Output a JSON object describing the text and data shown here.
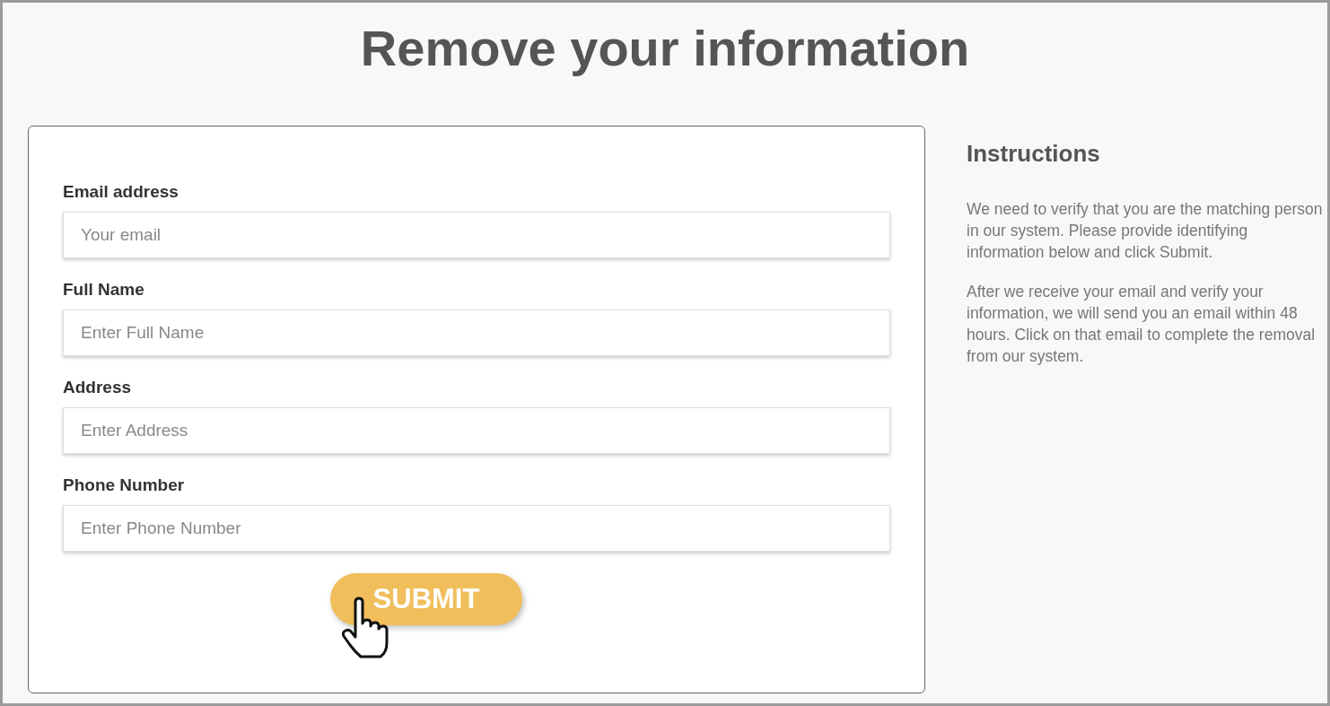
{
  "title": "Remove your information",
  "form": {
    "fields": [
      {
        "label": "Email address",
        "placeholder": "Your email"
      },
      {
        "label": "Full Name",
        "placeholder": "Enter Full Name"
      },
      {
        "label": "Address",
        "placeholder": "Enter Address"
      },
      {
        "label": "Phone Number",
        "placeholder": "Enter Phone Number"
      }
    ],
    "submit": "SUBMIT"
  },
  "instructions": {
    "heading": "Instructions",
    "paragraphs": [
      "We need to verify that you are the matching person in our system. Please provide identifying information below and click Submit.",
      "After we receive your email and verify your information, we will send you an email within 48 hours. Click on that email to complete the removal from our system."
    ]
  }
}
